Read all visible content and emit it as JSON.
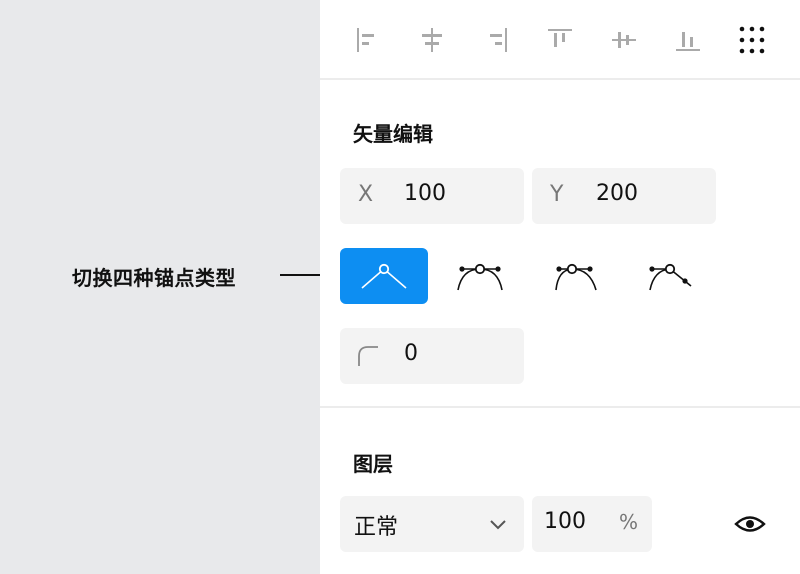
{
  "annotation": {
    "label": "切换四种锚点类型"
  },
  "toolbar": {
    "tools": [
      {
        "name": "align-left-icon"
      },
      {
        "name": "align-center-horizontal-icon"
      },
      {
        "name": "align-right-icon"
      },
      {
        "name": "align-top-icon"
      },
      {
        "name": "align-center-vertical-icon"
      },
      {
        "name": "align-bottom-icon"
      },
      {
        "name": "more-grid-icon"
      }
    ]
  },
  "vector_edit": {
    "title": "矢量编辑",
    "x_label": "X",
    "x_value": "100",
    "y_label": "Y",
    "y_value": "200",
    "anchor_types": [
      {
        "name": "anchor-type-corner",
        "active": true
      },
      {
        "name": "anchor-type-mirrored",
        "active": false
      },
      {
        "name": "anchor-type-asymmetric",
        "active": false
      },
      {
        "name": "anchor-type-disconnected",
        "active": false
      }
    ],
    "corner_radius_value": "0"
  },
  "layer": {
    "title": "图层",
    "blend_mode": "正常",
    "opacity_value": "100",
    "opacity_unit": "%"
  },
  "colors": {
    "accent": "#0d8ef2",
    "field_bg": "#f3f3f3",
    "left_bg": "#e8e9eb"
  }
}
